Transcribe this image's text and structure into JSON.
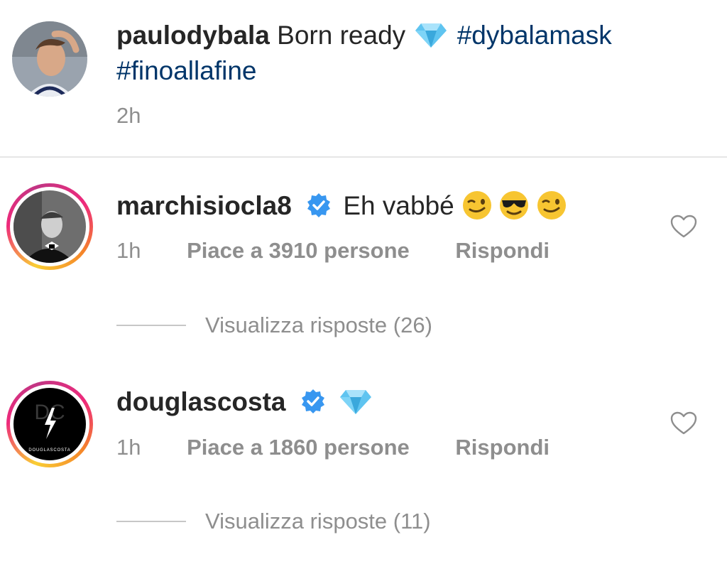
{
  "post": {
    "username": "paulodybala",
    "caption": "Born ready",
    "hashtags": [
      "#dybalamask",
      "#finoallafine"
    ],
    "time": "2h"
  },
  "comments": [
    {
      "username": "marchisiocla8",
      "text": "Eh vabbé",
      "time": "1h",
      "likes": "Piace a 3910 persone",
      "reply": "Rispondi",
      "view_replies": "Visualizza risposte (26)"
    },
    {
      "username": "douglascosta",
      "text": "",
      "time": "1h",
      "likes": "Piace a 1860 persone",
      "reply": "Rispondi",
      "view_replies": "Visualizza risposte (11)",
      "avatar_text": "DOUGLASCOSTA"
    }
  ],
  "icons": {
    "verified": "verified-badge-icon",
    "heart": "heart-outline-icon",
    "gem": "gem-stone-emoji",
    "wink": "winking-face-emoji",
    "sunglasses": "smiling-face-with-sunglasses-emoji"
  },
  "colors": {
    "hashtag": "#003569",
    "verified": "#3897f0",
    "meta": "#8e8e8e"
  }
}
